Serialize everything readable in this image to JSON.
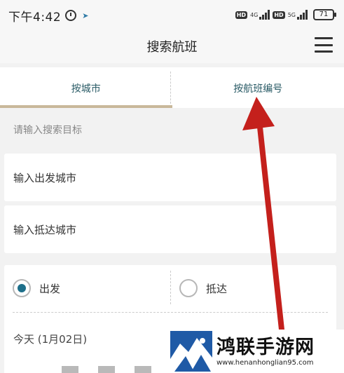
{
  "status_bar": {
    "time": "下午4:42",
    "hd_badge": "HD",
    "network_1": "4G",
    "network_2": "5G",
    "battery": "71"
  },
  "header": {
    "title": "搜索航班"
  },
  "tabs": [
    {
      "label": "按城市",
      "selected": true
    },
    {
      "label": "按航班编号",
      "selected": false
    }
  ],
  "search": {
    "hint": "请输入搜索目标",
    "departure_placeholder": "输入出发城市",
    "arrival_placeholder": "输入抵达城市"
  },
  "options": {
    "depart_label": "出发",
    "arrive_label": "抵达",
    "selected": "depart",
    "date": "今天 (1月02日)"
  },
  "colors": {
    "accent": "#1e6f8a",
    "tab_underline": "#c9b89a",
    "annotation_arrow": "#c4201c"
  },
  "watermark": {
    "name": "鸿联手游网",
    "url": "www.henanhonglian95.com"
  }
}
